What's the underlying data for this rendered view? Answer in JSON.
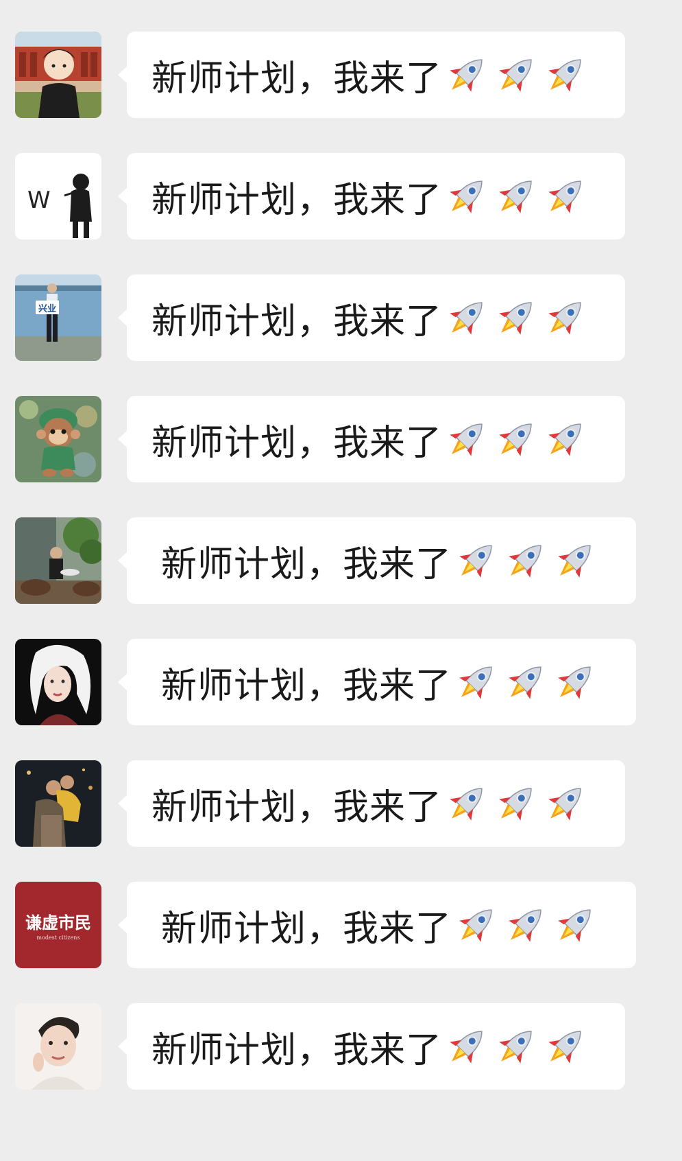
{
  "messages": [
    {
      "text": "新师计划，我来了",
      "emoji": [
        "rocket-emoji",
        "rocket-emoji",
        "rocket-emoji"
      ]
    },
    {
      "text": "新师计划，我来了",
      "emoji": [
        "rocket-emoji",
        "rocket-emoji",
        "rocket-emoji"
      ]
    },
    {
      "text": "新师计划，我来了",
      "emoji": [
        "rocket-emoji",
        "rocket-emoji",
        "rocket-emoji"
      ]
    },
    {
      "text": "新师计划，我来了",
      "emoji": [
        "rocket-emoji",
        "rocket-emoji",
        "rocket-emoji"
      ]
    },
    {
      "text": "新师计划，我来了",
      "emoji": [
        "rocket-emoji",
        "rocket-emoji",
        "rocket-emoji"
      ]
    },
    {
      "text": "新师计划，我来了",
      "emoji": [
        "rocket-emoji",
        "rocket-emoji",
        "rocket-emoji"
      ]
    },
    {
      "text": "新师计划，我来了",
      "emoji": [
        "rocket-emoji",
        "rocket-emoji",
        "rocket-emoji"
      ]
    },
    {
      "text": "新师计划，我来了",
      "emoji": [
        "rocket-emoji",
        "rocket-emoji",
        "rocket-emoji"
      ]
    },
    {
      "text": "新师计划，我来了",
      "emoji": [
        "rocket-emoji",
        "rocket-emoji",
        "rocket-emoji"
      ]
    }
  ],
  "avatars": {
    "a2_letter": "W",
    "a3_sign": "兴业",
    "a8_title": "谦虚市民",
    "a8_subtitle": "modest citizens"
  },
  "colors": {
    "background": "#ededed",
    "bubble": "#ffffff",
    "text": "#1a1a1a",
    "avatar8_red": "#a3282d"
  }
}
